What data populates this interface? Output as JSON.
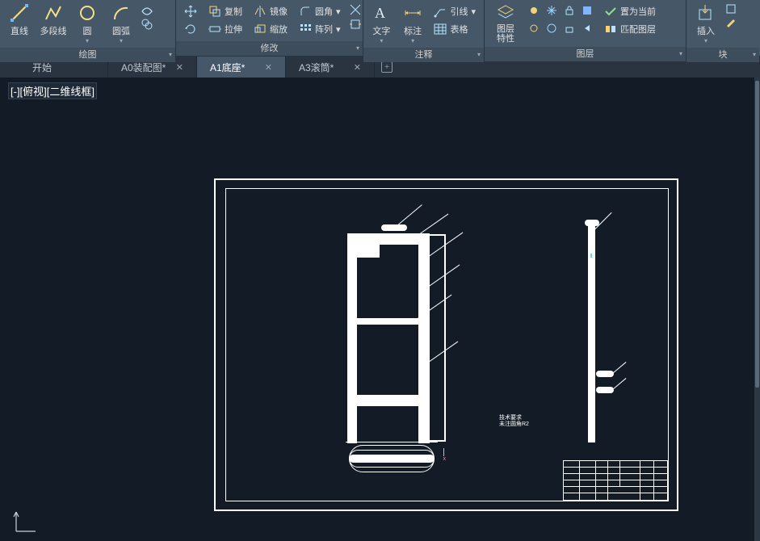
{
  "ribbon": {
    "draw": {
      "title": "绘图",
      "line": "直线",
      "polyline": "多段线",
      "circle": "圆",
      "arc": "圆弧"
    },
    "modify": {
      "title": "修改",
      "copy": "复制",
      "mirror": "镜像",
      "fillet": "圆角",
      "stretch": "拉伸",
      "scale": "缩放",
      "array": "阵列"
    },
    "annotate": {
      "title": "注释",
      "text": "文字",
      "dim": "标注",
      "leader": "引线",
      "table": "表格"
    },
    "layer": {
      "title": "图层",
      "props": "图层\n特性",
      "setcurrent": "置为当前",
      "matchlayer": "匹配图层"
    },
    "block": {
      "title": "块",
      "insert": "插入"
    }
  },
  "tabs": {
    "t0": "开始",
    "t1": "A0装配图*",
    "t2": "A1底座*",
    "t3": "A3滚筒*"
  },
  "viewport": {
    "label": "[-][俯视][二维线框]"
  },
  "drawing": {
    "tech_req_title": "技术要求",
    "tech_req_line": "未注圆角R2"
  }
}
